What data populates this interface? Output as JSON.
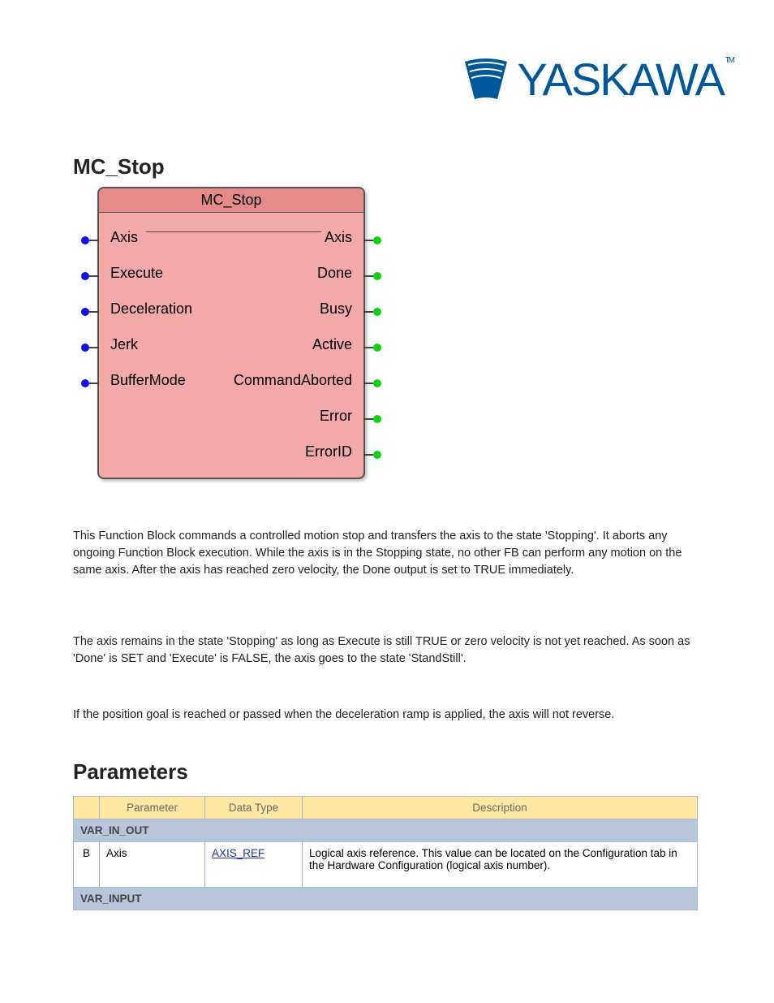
{
  "logo": {
    "text": "YASKAWA",
    "tm": "TM"
  },
  "heading": "MC_Stop",
  "fb": {
    "title": "MC_Stop",
    "inputs": [
      "Axis",
      "Execute",
      "Deceleration",
      "Jerk",
      "BufferMode"
    ],
    "outputs": [
      "Axis",
      "Done",
      "Busy",
      "Active",
      "CommandAborted",
      "Error",
      "ErrorID"
    ]
  },
  "paragraphs": {
    "p1": "This Function Block commands a controlled motion stop and transfers the axis to the state 'Stopping'. It aborts any ongoing Function Block execution. While the axis is in the Stopping state, no other FB can perform any motion on the same axis. After the axis has reached zero velocity, the Done output is set to TRUE immediately.",
    "p2": "The axis remains in the state 'Stopping' as long as Execute is still TRUE or zero velocity is not yet reached. As soon as 'Done' is SET and 'Execute' is FALSE, the axis goes to the state 'StandStill'.",
    "p3": "If the position goal is reached or passed when the deceleration ramp is applied, the axis will not reverse."
  },
  "params_heading": "Parameters",
  "table": {
    "headers": [
      "",
      "Parameter",
      "Data Type",
      "Description"
    ],
    "sections": [
      {
        "label": "VAR_IN_OUT",
        "rows": [
          {
            "letter": "B",
            "param": "Axis",
            "type_link": "AXIS_REF",
            "desc": "Logical axis reference. This value can be located on the Configuration tab in the Hardware Configuration (logical axis number)."
          }
        ]
      },
      {
        "label": "VAR_INPUT",
        "rows": []
      }
    ]
  }
}
